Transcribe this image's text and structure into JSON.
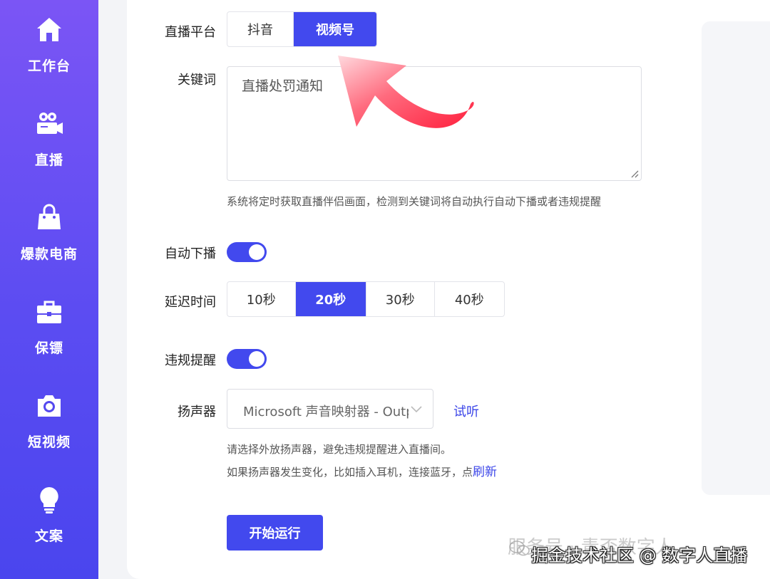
{
  "sidebar": {
    "items": [
      {
        "label": "工作台",
        "icon": "home-icon"
      },
      {
        "label": "直播",
        "icon": "video-camera-icon"
      },
      {
        "label": "爆款电商",
        "icon": "shopping-bag-icon"
      },
      {
        "label": "保镖",
        "icon": "briefcase-icon"
      },
      {
        "label": "短视频",
        "icon": "camera-icon"
      },
      {
        "label": "文案",
        "icon": "lightbulb-icon"
      }
    ]
  },
  "form": {
    "platform": {
      "label": "直播平台",
      "options": [
        "抖音",
        "视频号"
      ],
      "selected": "视频号"
    },
    "keywords": {
      "label": "关键词",
      "value": "直播处罚通知",
      "hint": "系统将定时获取直播伴侣画面，检测到关键词将自动执行自动下播或者违规提醒"
    },
    "auto_stop": {
      "label": "自动下播",
      "on": true
    },
    "delay": {
      "label": "延迟时间",
      "options": [
        "10秒",
        "20秒",
        "30秒",
        "40秒"
      ],
      "selected": "20秒"
    },
    "violation_alert": {
      "label": "违规提醒",
      "on": true
    },
    "speaker": {
      "label": "扬声器",
      "value": "Microsoft 声音映射器 - Output",
      "listen_label": "试听",
      "hint1": "请选择外放扬声器，避免违规提醒进入直播间。",
      "hint2": "如果扬声器发生变化，比如插入耳机，连接蓝牙，点",
      "refresh_label": "刷新"
    },
    "start_button": "开始运行"
  },
  "watermarks": {
    "wechat": "服务号 · 青否数字人",
    "juejin": "掘金技术社区 @ 数字人直播"
  },
  "colors": {
    "accent": "#4249ee",
    "sidebar_top": "#7b55f5",
    "sidebar_bottom": "#4a45ee",
    "arrow": "#ff2a45"
  }
}
